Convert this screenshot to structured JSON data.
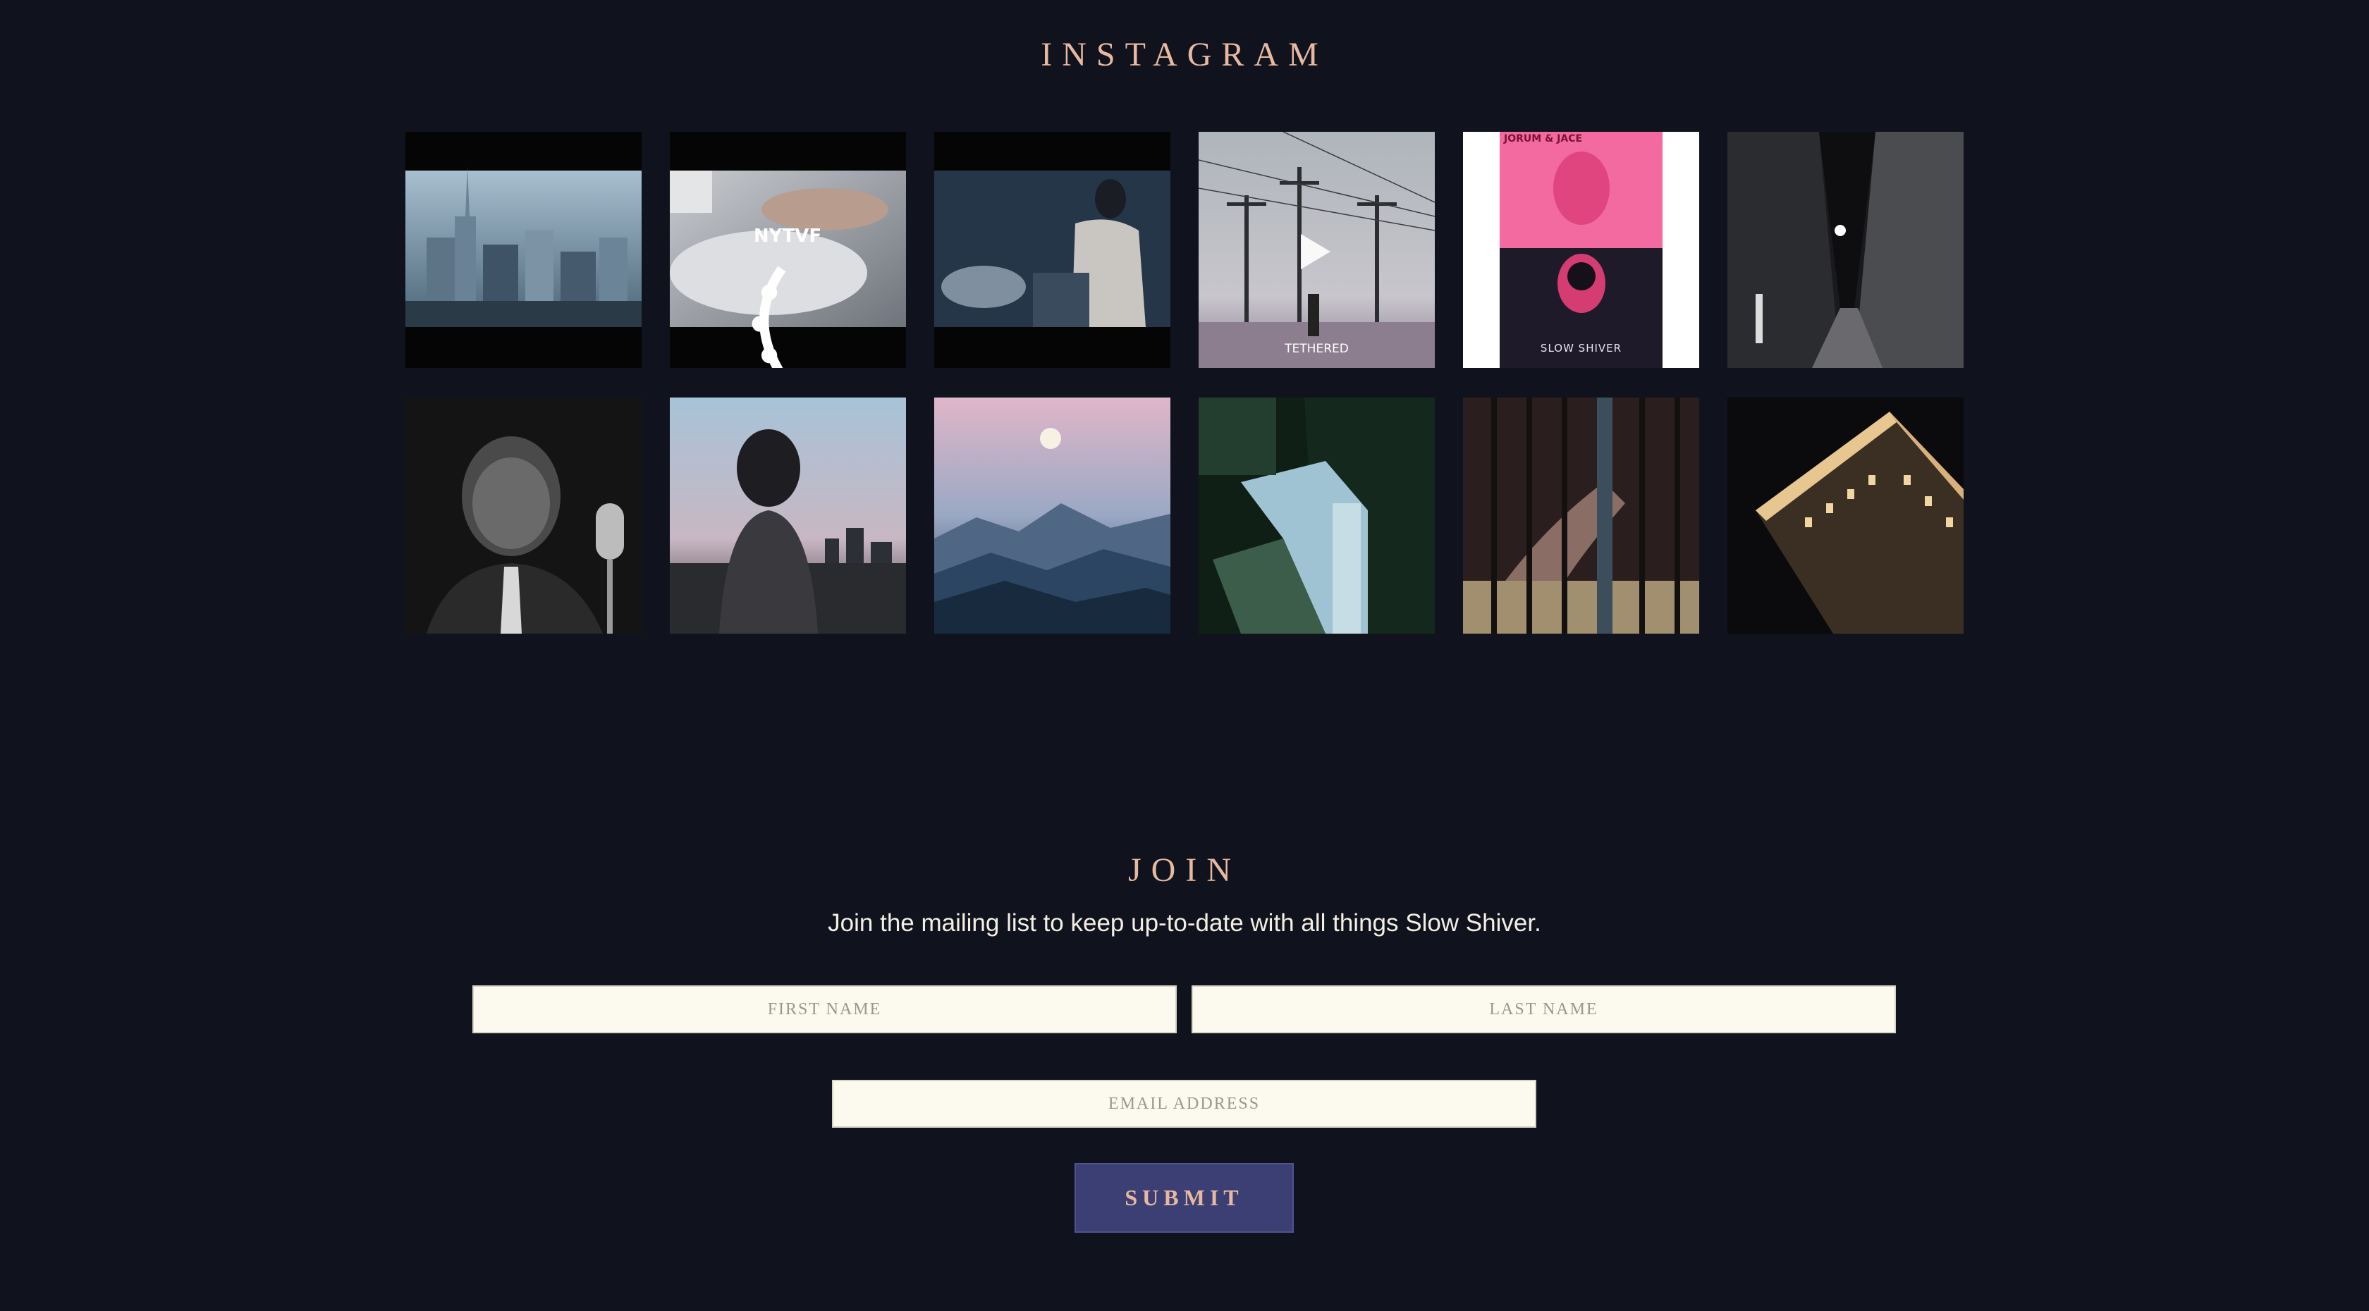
{
  "instagram": {
    "title": "INSTAGRAM",
    "posts": [
      {
        "subject": "city skyline at dusk"
      },
      {
        "subject": "couple in bed with festival laurel",
        "laurel_text": "NYTVF"
      },
      {
        "subject": "man sitting on bed at night"
      },
      {
        "subject": "power lines in field, video",
        "caption": "TETHERED"
      },
      {
        "subject": "pink poster",
        "caption_top": "JORUM & JACE",
        "caption_bottom": "SLOW SHIVER"
      },
      {
        "subject": "dark city alley at night"
      },
      {
        "subject": "black and white portrait at microphone"
      },
      {
        "subject": "silhouette against city dusk"
      },
      {
        "subject": "moon over mountain range"
      },
      {
        "subject": "teal lit building from above"
      },
      {
        "subject": "figure behind blinds"
      },
      {
        "subject": "lit building corner at night"
      }
    ]
  },
  "join": {
    "title": "JOIN",
    "subtitle": "Join the mailing list to keep up-to-date with all things Slow Shiver.",
    "first_name_placeholder": "FIRST NAME",
    "last_name_placeholder": "LAST NAME",
    "email_placeholder": "EMAIL ADDRESS",
    "submit_label": "SUBMIT"
  },
  "colors": {
    "background": "#10131e",
    "accent": "#e8b9a0",
    "button": "#3b3f73",
    "field": "#fcf9ef"
  },
  "icons": [
    "play-icon",
    "laurel-icon"
  ]
}
